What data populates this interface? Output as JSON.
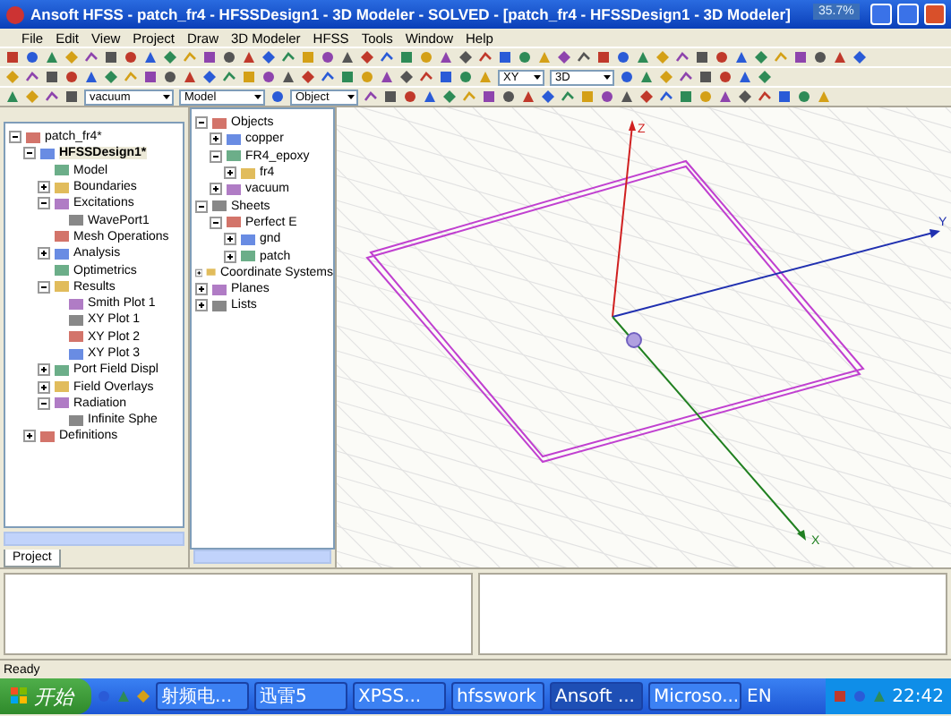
{
  "window": {
    "title": "Ansoft HFSS - patch_fr4 - HFSSDesign1 - 3D Modeler - SOLVED - [patch_fr4 - HFSSDesign1 - 3D Modeler]"
  },
  "cpu_badge": "35.7%",
  "menu": [
    "File",
    "Edit",
    "View",
    "Project",
    "Draw",
    "3D Modeler",
    "HFSS",
    "Tools",
    "Window",
    "Help"
  ],
  "toolbar": {
    "material": "vacuum",
    "mode": "Model",
    "selection": "Object",
    "plane": "XY",
    "view": "3D"
  },
  "project_tree": [
    {
      "label": "patch_fr4*",
      "expanded": true,
      "children": [
        {
          "label": "HFSSDesign1*",
          "expanded": true,
          "selected": true,
          "children": [
            {
              "label": "Model"
            },
            {
              "label": "Boundaries",
              "expanded": false
            },
            {
              "label": "Excitations",
              "expanded": true,
              "children": [
                {
                  "label": "WavePort1"
                }
              ]
            },
            {
              "label": "Mesh Operations"
            },
            {
              "label": "Analysis",
              "expanded": false
            },
            {
              "label": "Optimetrics"
            },
            {
              "label": "Results",
              "expanded": true,
              "children": [
                {
                  "label": "Smith Plot 1"
                },
                {
                  "label": "XY Plot 1"
                },
                {
                  "label": "XY Plot 2"
                },
                {
                  "label": "XY Plot 3"
                }
              ]
            },
            {
              "label": "Port Field Displ",
              "expanded": false
            },
            {
              "label": "Field Overlays",
              "expanded": false
            },
            {
              "label": "Radiation",
              "expanded": true,
              "children": [
                {
                  "label": "Infinite Sphe"
                }
              ]
            }
          ]
        },
        {
          "label": "Definitions",
          "expanded": false
        }
      ]
    }
  ],
  "project_tab": "Project",
  "object_tree": [
    {
      "label": "Objects",
      "expanded": true,
      "children": [
        {
          "label": "copper",
          "expanded": false
        },
        {
          "label": "FR4_epoxy",
          "expanded": true,
          "children": [
            {
              "label": "fr4",
              "expanded": false
            }
          ]
        },
        {
          "label": "vacuum",
          "expanded": false
        }
      ]
    },
    {
      "label": "Sheets",
      "expanded": true,
      "children": [
        {
          "label": "Perfect E",
          "expanded": true,
          "children": [
            {
              "label": "gnd",
              "expanded": false
            },
            {
              "label": "patch",
              "expanded": false
            }
          ]
        }
      ]
    },
    {
      "label": "Coordinate Systems",
      "expanded": false
    },
    {
      "label": "Planes",
      "expanded": false
    },
    {
      "label": "Lists",
      "expanded": false
    }
  ],
  "viewport": {
    "axes": [
      "Z",
      "Y",
      "X"
    ]
  },
  "status_bar": {
    "text": "Ready"
  },
  "taskbar": {
    "start": "开始",
    "tasks": [
      {
        "label": "射频电...",
        "selected": false
      },
      {
        "label": "迅雷5",
        "selected": false
      },
      {
        "label": "XPSS...",
        "selected": false
      },
      {
        "label": "hfsswork",
        "selected": false
      },
      {
        "label": "Ansoft ...",
        "selected": true
      },
      {
        "label": "Microso...",
        "selected": false
      }
    ],
    "language": "EN",
    "clock": "22:42"
  }
}
